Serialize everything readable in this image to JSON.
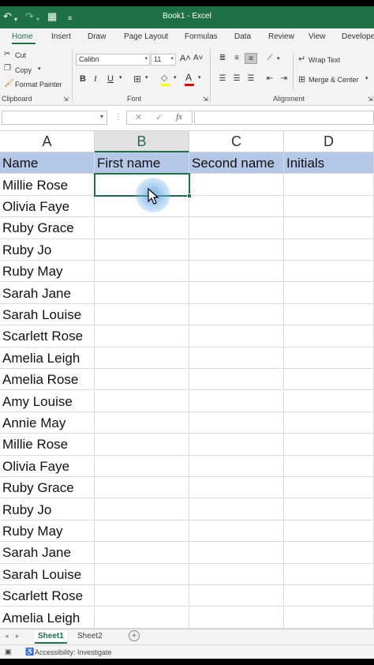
{
  "window": {
    "title": "Book1  -  Excel"
  },
  "quick_access": {
    "undo_icon": "undo-icon",
    "redo_icon": "redo-icon",
    "form_icon": "form-icon",
    "customize_icon": "customize-icon"
  },
  "ribbon_tabs": [
    "Home",
    "Insert",
    "Draw",
    "Page Layout",
    "Formulas",
    "Data",
    "Review",
    "View",
    "Develope"
  ],
  "clipboard": {
    "cut": "Cut",
    "copy": "Copy",
    "format_painter": "Format Painter",
    "label": "Clipboard"
  },
  "font": {
    "name": "Calibri",
    "size": "11",
    "bold": "B",
    "italic": "I",
    "underline": "U",
    "grow": "A˄",
    "shrink": "A˅",
    "label": "Font"
  },
  "alignment": {
    "wrap_text": "Wrap Text",
    "merge_center": "Merge & Center",
    "label": "Alignment"
  },
  "formula_bar": {
    "fx": "fx"
  },
  "grid": {
    "columns": [
      "A",
      "B",
      "C",
      "D"
    ],
    "selected_column": "B",
    "header_row": [
      "Name",
      "First name",
      "Second name",
      "Initials"
    ],
    "names": [
      "Millie Rose",
      "Olivia Faye",
      "Ruby Grace",
      "Ruby Jo",
      "Ruby May",
      "Sarah Jane",
      "Sarah Louise",
      "Scarlett Rose",
      "Amelia Leigh",
      "Amelia Rose",
      "Amy Louise",
      "Annie May",
      "Millie Rose",
      "Olivia Faye",
      "Ruby Grace",
      "Ruby Jo",
      "Ruby May",
      "Sarah Jane",
      "Sarah Louise",
      "Scarlett Rose",
      "Amelia Leigh"
    ],
    "header_fill": "#b4c7e7",
    "accent": "#1e7145"
  },
  "sheets": [
    "Sheet1",
    "Sheet2"
  ],
  "active_sheet": "Sheet1",
  "status": {
    "accessibility": "Accessibility: Investigate"
  }
}
